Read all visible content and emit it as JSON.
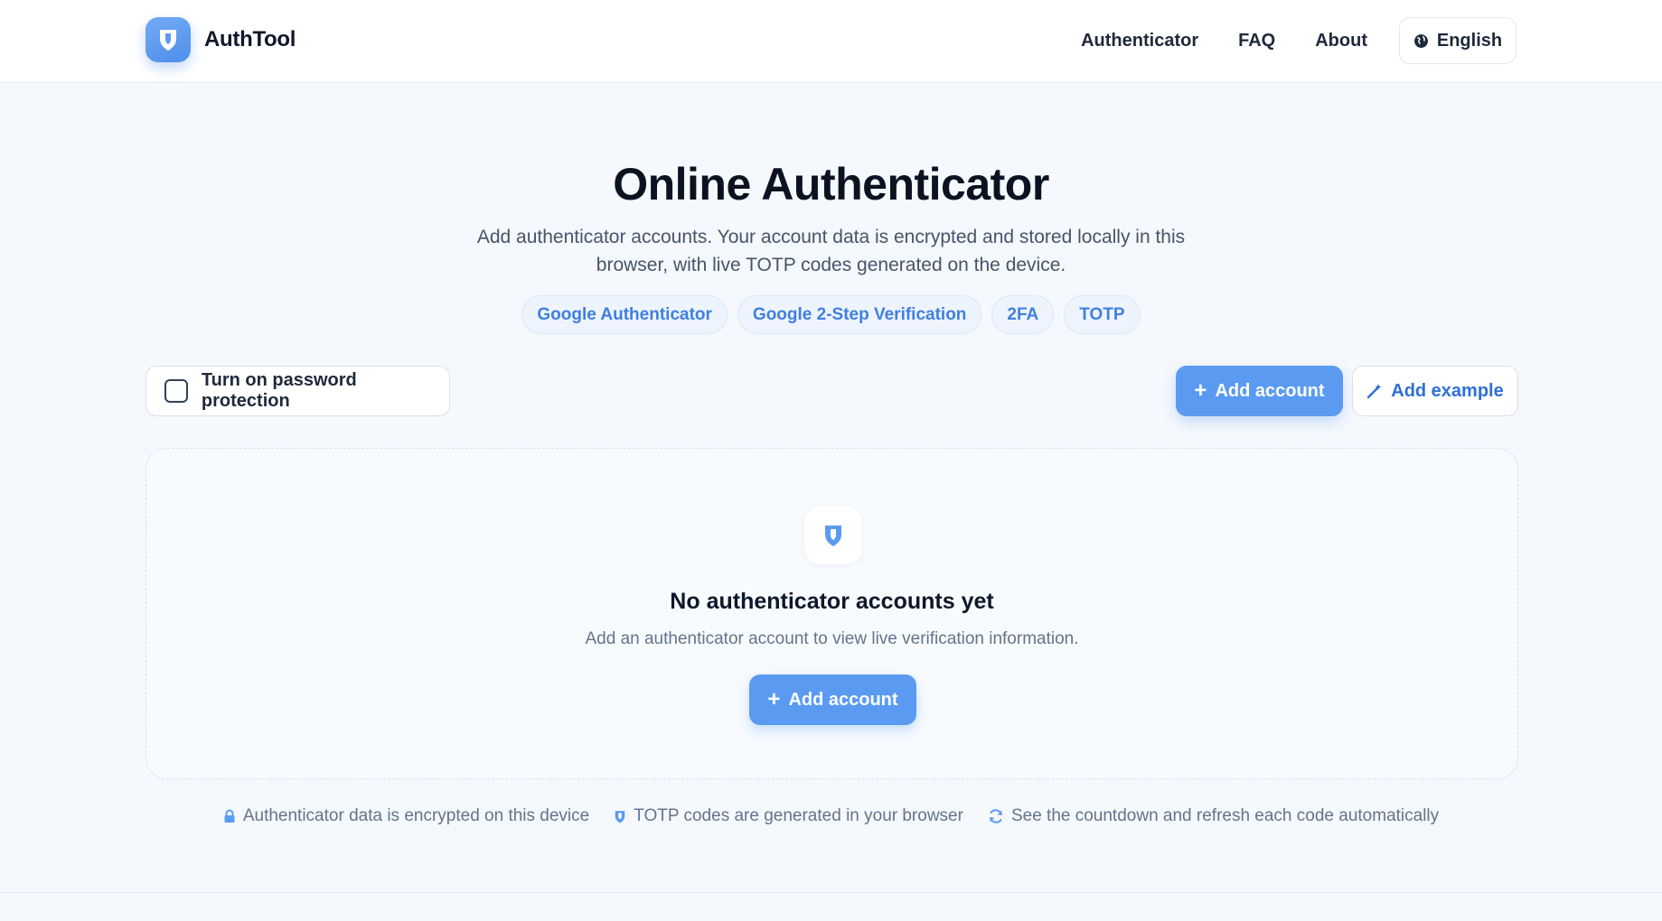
{
  "header": {
    "brand": "AuthTool",
    "nav": [
      {
        "label": "Authenticator"
      },
      {
        "label": "FAQ"
      },
      {
        "label": "About"
      }
    ],
    "language": "English"
  },
  "hero": {
    "title": "Online Authenticator",
    "subtitle": "Add authenticator accounts. Your account data is encrypted and stored locally in this browser, with live TOTP codes generated on the device.",
    "tags": [
      "Google Authenticator",
      "Google 2-Step Verification",
      "2FA",
      "TOTP"
    ]
  },
  "toolbar": {
    "password_protection_label": "Turn on password protection",
    "password_protection_checked": false,
    "add_account_label": "Add account",
    "add_example_label": "Add example"
  },
  "empty_state": {
    "title": "No authenticator accounts yet",
    "description": "Add an authenticator account to view live verification information.",
    "add_account_label": "Add account"
  },
  "features": [
    {
      "icon": "lock-icon",
      "text": "Authenticator data is encrypted on this device"
    },
    {
      "icon": "shield-icon",
      "text": "TOTP codes are generated in your browser"
    },
    {
      "icon": "refresh-icon",
      "text": "See the countdown and refresh each code automatically"
    }
  ],
  "colors": {
    "accent": "#5a9bf1",
    "tag_text": "#3f7fe0",
    "background": "#f5f8fc"
  }
}
